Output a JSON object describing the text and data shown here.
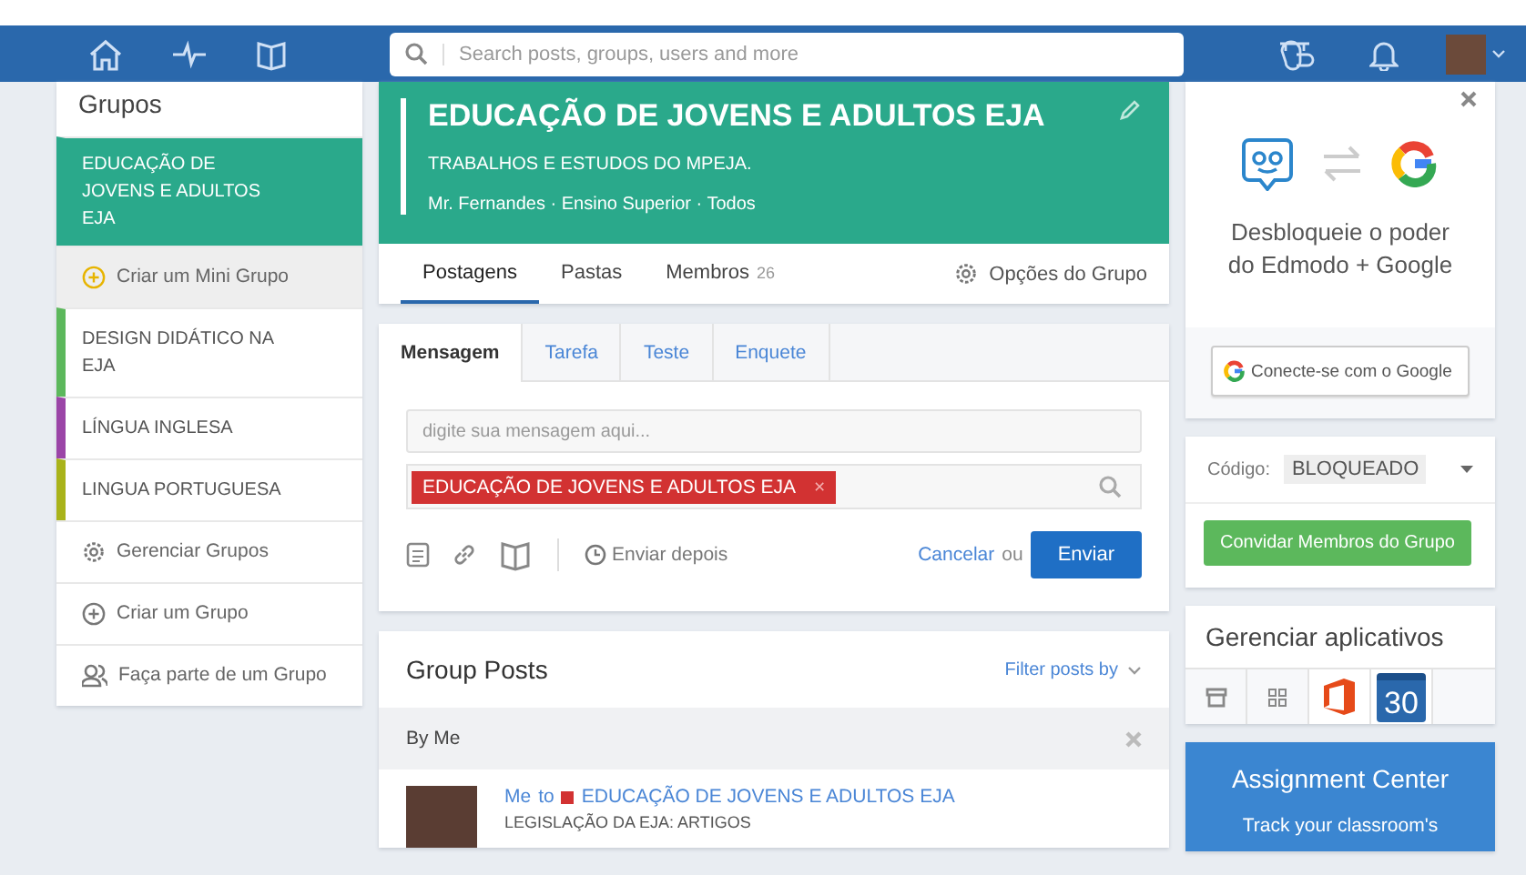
{
  "nav": {
    "search_placeholder": "Search posts, groups, users and more"
  },
  "sidebar": {
    "title": "Grupos",
    "items": [
      {
        "kind": "group",
        "label": "EDUCAÇÃO DE JOVENS E ADULTOS EJA",
        "selected": true,
        "color": "#2aa98b"
      },
      {
        "kind": "subgroup",
        "label": "Criar um Mini Grupo"
      },
      {
        "kind": "group",
        "label": "DESIGN DIDÁTICO NA EJA",
        "selected": false,
        "color": "#5cb85c"
      },
      {
        "kind": "group",
        "label": "LÍNGUA INGLESA",
        "selected": false,
        "color": "#9b45a7"
      },
      {
        "kind": "group",
        "label": "LINGUA PORTUGUESA",
        "selected": false,
        "color": "#a9b31a"
      },
      {
        "kind": "manage",
        "label": "Gerenciar Grupos"
      },
      {
        "kind": "create",
        "label": "Criar um Grupo"
      },
      {
        "kind": "join",
        "label": "Faça parte de um Grupo"
      }
    ]
  },
  "group": {
    "title": "EDUCAÇÃO DE JOVENS E ADULTOS EJA",
    "subtitle": "TRABALHOS E ESTUDOS DO MPEJA.",
    "meta": "Mr. Fernandes · Ensino Superior · Todos",
    "tabs": [
      {
        "label": "Postagens",
        "selected": true
      },
      {
        "label": "Pastas",
        "selected": false
      },
      {
        "label": "Membros",
        "count": "26",
        "selected": false
      }
    ],
    "options": "Opções do Grupo"
  },
  "composer": {
    "tabs": [
      {
        "label": "Mensagem",
        "selected": true
      },
      {
        "label": "Tarefa",
        "selected": false
      },
      {
        "label": "Teste",
        "selected": false
      },
      {
        "label": "Enquete",
        "selected": false
      }
    ],
    "placeholder": "digite sua mensagem aqui...",
    "recipient": "EDUCAÇÃO DE JOVENS E ADULTOS EJA",
    "remove": "×",
    "schedule": "Enviar depois",
    "cancel": "Cancelar",
    "or": "ou",
    "send": "Enviar"
  },
  "posts": {
    "title": "Group Posts",
    "filter": "Filter posts by",
    "section": "By Me",
    "items": [
      {
        "author": "Me",
        "to": "to",
        "group": "EDUCAÇÃO DE JOVENS E ADULTOS EJA",
        "text": "LEGISLAÇÃO DA EJA: ARTIGOS"
      }
    ]
  },
  "promo": {
    "text": "Desbloqueie o poder do Edmodo + Google",
    "button": "Conecte-se com o Google"
  },
  "code": {
    "label": "Código:",
    "value": "BLOQUEADO",
    "invite": "Convidar Membros do Grupo"
  },
  "apps": {
    "title": "Gerenciar aplicativos",
    "calendar_day": "30"
  },
  "assignment": {
    "title": "Assignment Center",
    "text": "Track your classroom's"
  }
}
